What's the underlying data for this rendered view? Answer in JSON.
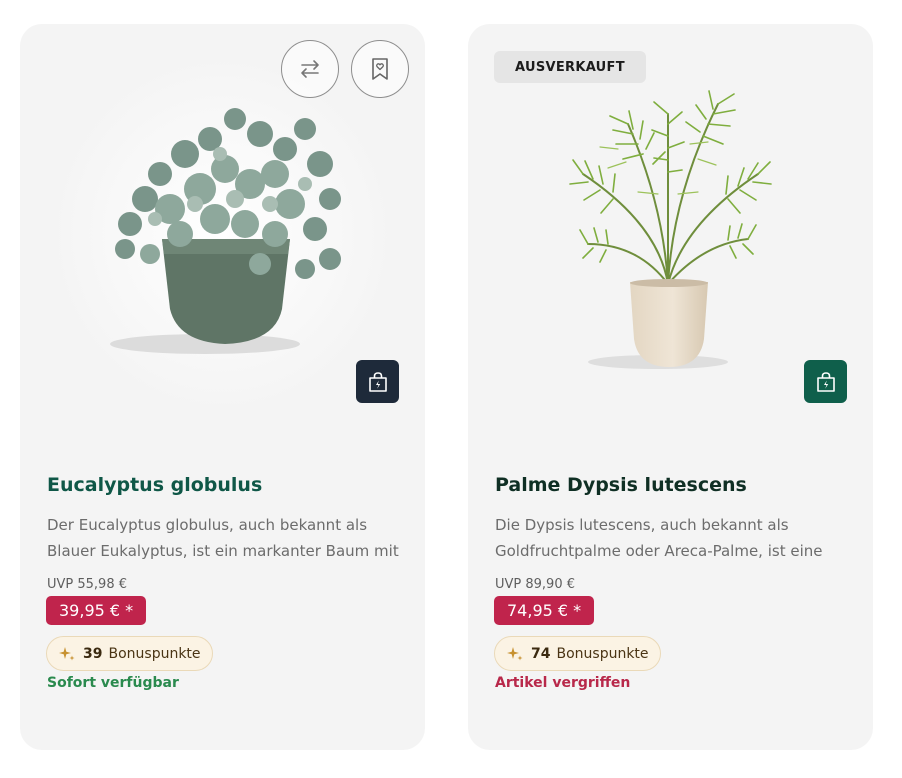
{
  "products": [
    {
      "title": "Eucalyptus globulus",
      "image_alt": "eucalyptus-plant-photo",
      "description": "Der Eucalyptus globulus, auch bekannt als Blauer Eukalyptus, ist ein markanter Baum mit",
      "uvp": "UVP 55,98 €",
      "price": "39,95 € *",
      "bonus_points": "39",
      "bonus_label": "Bonuspunkte",
      "availability": "Sofort verfügbar",
      "quickbuy_color": "#1e2a3a"
    },
    {
      "badge": "AUSVERKAUFT",
      "title": "Palme Dypsis lutescens",
      "image_alt": "areca-palm-photo",
      "description": "Die Dypsis lutescens, auch bekannt als Goldfruchtpalme oder Areca-Palme, ist eine",
      "uvp": "UVP 89,90 €",
      "price": "74,95 € *",
      "bonus_points": "74",
      "bonus_label": "Bonuspunkte",
      "availability": "Artikel vergriffen",
      "quickbuy_color": "#0f5f4b"
    }
  ],
  "colors": {
    "price_bg": "#c0244c",
    "available": "#2a8a4e",
    "sold_out": "#b8284a",
    "title_green": "#0f5747"
  },
  "icons": {
    "compare": "arrows-swap-icon",
    "wishlist": "bookmark-heart-icon",
    "quickbuy": "shopping-bag-bolt-icon",
    "bonus": "sparkle-icon"
  }
}
